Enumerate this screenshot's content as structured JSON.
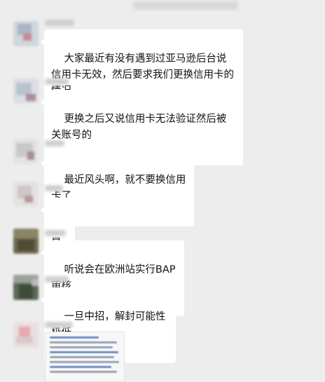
{
  "conversation": {
    "messages": [
      {
        "text": "大家最近有没有遇到过亚马逊后台说信用卡无效，然后要求我们更换信用卡的情况"
      },
      {
        "text": "更换之后又说信用卡无法验证然后被关账号的"
      },
      {
        "text": "最近风头啊，就不要换信用卡了"
      },
      {
        "text": "是的"
      },
      {
        "text": "听说会在欧洲站实行BAP审核"
      },
      {
        "text": "一旦中招，解封可能性极低"
      }
    ]
  },
  "colors": {
    "background": "#ededed",
    "bubble": "#ffffff",
    "text": "#111111"
  }
}
